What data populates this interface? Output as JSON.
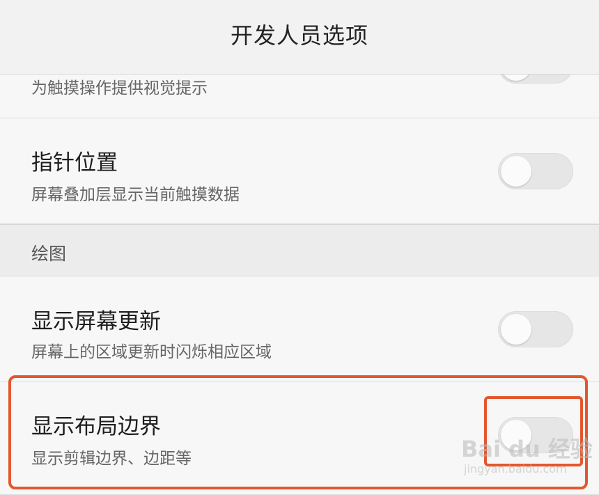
{
  "header": {
    "title": "开发人员选项"
  },
  "rows": [
    {
      "subtitle": "为触摸操作提供视觉提示",
      "toggle_on": false
    },
    {
      "title": "指针位置",
      "subtitle": "屏幕叠加层显示当前触摸数据",
      "toggle_on": false
    },
    {
      "title": "显示屏幕更新",
      "subtitle": "屏幕上的区域更新时闪烁相应区域",
      "toggle_on": false
    },
    {
      "title": "显示布局边界",
      "subtitle": "显示剪辑边界、边距等",
      "toggle_on": false
    }
  ],
  "section": {
    "label": "绘图"
  },
  "watermark": {
    "main": "Bai du 经验",
    "sub": "jingyan.baidu.com"
  },
  "colors": {
    "highlight": "#e4572e",
    "toggle_off": "#e6e6e6"
  }
}
